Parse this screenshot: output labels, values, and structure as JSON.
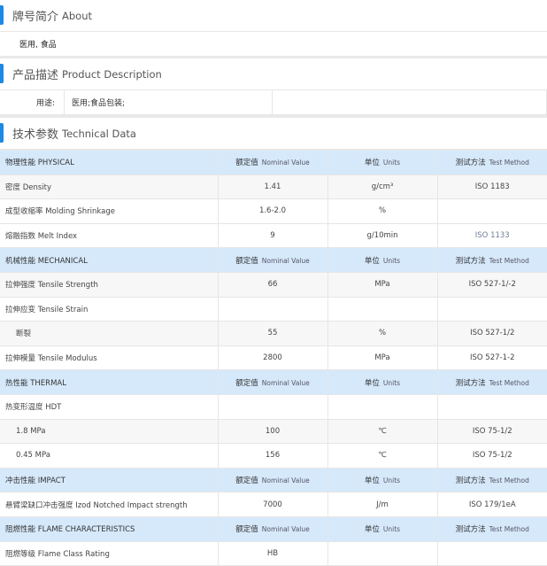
{
  "about": {
    "title_cn": "牌号简介",
    "title_en": "About",
    "text": "医用, 食品"
  },
  "description": {
    "title_cn": "产品描述",
    "title_en": "Product Description",
    "label": "用途:",
    "value": "医用;食品包装;"
  },
  "technical": {
    "title_cn": "技术参数",
    "title_en": "Technical Data",
    "columns": {
      "nominal_cn": "额定值",
      "nominal_en": "Nominal Value",
      "units_cn": "单位",
      "units_en": "Units",
      "method_cn": "测试方法",
      "method_en": "Test Method"
    },
    "header_color": "#d6e9fb",
    "groups": [
      {
        "name": "物理性能 PHYSICAL",
        "rows": [
          {
            "property": "密度 Density",
            "value": "1.41",
            "unit": "g/cm³",
            "method": "ISO 1183",
            "alt": true
          },
          {
            "property": "成型收缩率 Molding Shrinkage",
            "value": "1.6-2.0",
            "unit": "%",
            "method": ""
          },
          {
            "property": "熔融指数 Melt Index",
            "value": "9",
            "unit": "g/10min",
            "method": "ISO 1133",
            "muted": true
          }
        ]
      },
      {
        "name": "机械性能 MECHANICAL",
        "rows": [
          {
            "property": "拉伸强度 Tensile Strength",
            "value": "66",
            "unit": "MPa",
            "method": "ISO 527-1/-2",
            "alt": true
          },
          {
            "property": "拉伸应变 Tensile Strain",
            "value": "",
            "unit": "",
            "method": ""
          },
          {
            "property": "断裂",
            "value": "55",
            "unit": "%",
            "method": "ISO 527-1/2",
            "alt": true,
            "sub": true
          },
          {
            "property": "拉伸模量 Tensile Modulus",
            "value": "2800",
            "unit": "MPa",
            "method": "ISO 527-1-2"
          }
        ]
      },
      {
        "name": "热性能 THERMAL",
        "rows": [
          {
            "property": "热变形温度 HDT",
            "value": "",
            "unit": "",
            "method": ""
          },
          {
            "property": "1.8 MPa",
            "value": "100",
            "unit": "℃",
            "method": "ISO 75-1/2",
            "alt": true,
            "sub": true
          },
          {
            "property": "0.45 MPa",
            "value": "156",
            "unit": "℃",
            "method": "ISO 75-1/2",
            "sub": true
          }
        ]
      },
      {
        "name": "冲击性能 IMPACT",
        "rows": [
          {
            "property": "悬臂梁缺口冲击强度 Izod Notched Impact strength",
            "value": "7000",
            "unit": "J/m",
            "method": "ISO 179/1eA"
          }
        ]
      },
      {
        "name": "阻燃性能 FLAME CHARACTERISTICS",
        "rows": [
          {
            "property": "阻燃等级 Flame Class Rating",
            "value": "HB",
            "unit": "",
            "method": ""
          }
        ]
      }
    ]
  }
}
